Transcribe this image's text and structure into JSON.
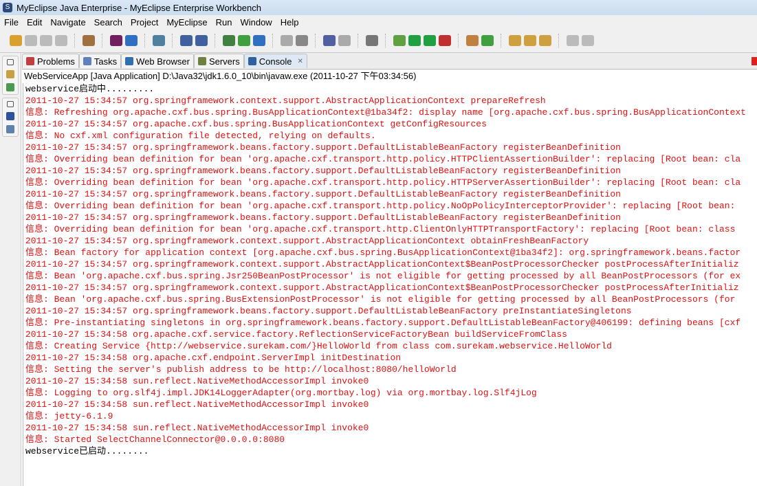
{
  "window": {
    "title": "MyEclipse Java Enterprise - MyEclipse Enterprise Workbench"
  },
  "menu": [
    "File",
    "Edit",
    "Navigate",
    "Search",
    "Project",
    "MyEclipse",
    "Run",
    "Window",
    "Help"
  ],
  "tabs": [
    {
      "label": "Problems"
    },
    {
      "label": "Tasks"
    },
    {
      "label": "Web Browser"
    },
    {
      "label": "Servers"
    },
    {
      "label": "Console",
      "close": "✕"
    }
  ],
  "console": {
    "header": "WebServiceApp [Java Application] D:\\Java32\\jdk1.6.0_10\\bin\\javaw.exe (2011-10-27 下午03:34:56)",
    "lines": [
      {
        "t": "webservice启动中.........",
        "out": true
      },
      {
        "t": "2011-10-27 15:34:57 org.springframework.context.support.AbstractApplicationContext prepareRefresh"
      },
      {
        "t": "信息: Refreshing org.apache.cxf.bus.spring.BusApplicationContext@1ba34f2: display name [org.apache.cxf.bus.spring.BusApplicationContext"
      },
      {
        "t": "2011-10-27 15:34:57 org.apache.cxf.bus.spring.BusApplicationContext getConfigResources"
      },
      {
        "t": "信息: No cxf.xml configuration file detected, relying on defaults."
      },
      {
        "t": "2011-10-27 15:34:57 org.springframework.beans.factory.support.DefaultListableBeanFactory registerBeanDefinition"
      },
      {
        "t": "信息: Overriding bean definition for bean 'org.apache.cxf.transport.http.policy.HTTPClientAssertionBuilder': replacing [Root bean: cla"
      },
      {
        "t": "2011-10-27 15:34:57 org.springframework.beans.factory.support.DefaultListableBeanFactory registerBeanDefinition"
      },
      {
        "t": "信息: Overriding bean definition for bean 'org.apache.cxf.transport.http.policy.HTTPServerAssertionBuilder': replacing [Root bean: cla"
      },
      {
        "t": "2011-10-27 15:34:57 org.springframework.beans.factory.support.DefaultListableBeanFactory registerBeanDefinition"
      },
      {
        "t": "信息: Overriding bean definition for bean 'org.apache.cxf.transport.http.policy.NoOpPolicyInterceptorProvider': replacing [Root bean: "
      },
      {
        "t": "2011-10-27 15:34:57 org.springframework.beans.factory.support.DefaultListableBeanFactory registerBeanDefinition"
      },
      {
        "t": "信息: Overriding bean definition for bean 'org.apache.cxf.transport.http.ClientOnlyHTTPTransportFactory': replacing [Root bean: class"
      },
      {
        "t": "2011-10-27 15:34:57 org.springframework.context.support.AbstractApplicationContext obtainFreshBeanFactory"
      },
      {
        "t": "信息: Bean factory for application context [org.apache.cxf.bus.spring.BusApplicationContext@1ba34f2]: org.springframework.beans.factor"
      },
      {
        "t": "2011-10-27 15:34:57 org.springframework.context.support.AbstractApplicationContext$BeanPostProcessorChecker postProcessAfterInitializ"
      },
      {
        "t": "信息: Bean 'org.apache.cxf.bus.spring.Jsr250BeanPostProcessor' is not eligible for getting processed by all BeanPostProcessors (for ex"
      },
      {
        "t": "2011-10-27 15:34:57 org.springframework.context.support.AbstractApplicationContext$BeanPostProcessorChecker postProcessAfterInitializ"
      },
      {
        "t": "信息: Bean 'org.apache.cxf.bus.spring.BusExtensionPostProcessor' is not eligible for getting processed by all BeanPostProcessors (for "
      },
      {
        "t": "2011-10-27 15:34:57 org.springframework.beans.factory.support.DefaultListableBeanFactory preInstantiateSingletons"
      },
      {
        "t": "信息: Pre-instantiating singletons in org.springframework.beans.factory.support.DefaultListableBeanFactory@406199: defining beans [cxf"
      },
      {
        "t": "2011-10-27 15:34:58 org.apache.cxf.service.factory.ReflectionServiceFactoryBean buildServiceFromClass"
      },
      {
        "t": "信息: Creating Service {http://webservice.surekam.com/}HelloWorld from class com.surekam.webservice.HelloWorld"
      },
      {
        "t": "2011-10-27 15:34:58 org.apache.cxf.endpoint.ServerImpl initDestination"
      },
      {
        "t": "信息: Setting the server's publish address to be http://localhost:8080/helloWorld"
      },
      {
        "t": "2011-10-27 15:34:58 sun.reflect.NativeMethodAccessorImpl invoke0"
      },
      {
        "t": "信息: Logging to org.slf4j.impl.JDK14LoggerAdapter(org.mortbay.log) via org.mortbay.log.Slf4jLog"
      },
      {
        "t": "2011-10-27 15:34:58 sun.reflect.NativeMethodAccessorImpl invoke0"
      },
      {
        "t": "信息: jetty-6.1.9"
      },
      {
        "t": "2011-10-27 15:34:58 sun.reflect.NativeMethodAccessorImpl invoke0"
      },
      {
        "t": "信息: Started SelectChannelConnector@0.0.0.0:8080"
      },
      {
        "t": "webservice已启动........",
        "out": true
      }
    ]
  },
  "colors": {
    "stderr": "#e01010",
    "stdout": "#000000"
  }
}
